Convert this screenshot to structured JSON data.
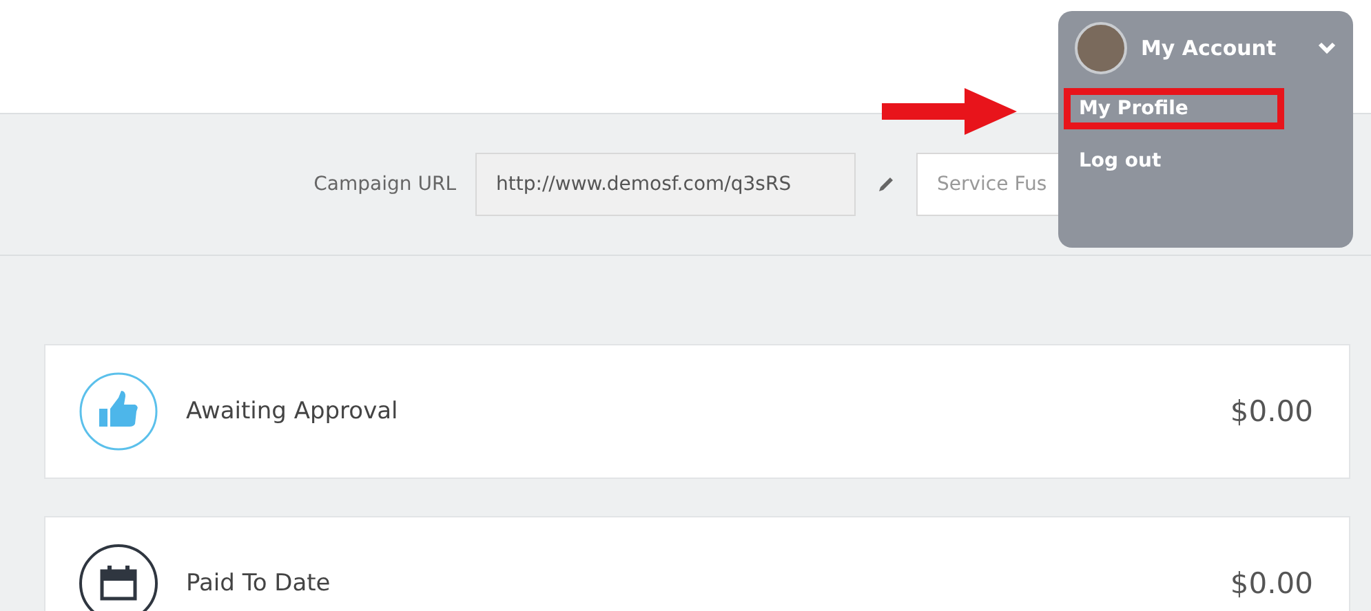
{
  "account_menu": {
    "label": "My Account",
    "expanded": true,
    "items": [
      {
        "label": "My Profile",
        "highlighted": true
      },
      {
        "label": "Log out",
        "highlighted": false
      }
    ]
  },
  "toolbar": {
    "campaign_url_label": "Campaign URL",
    "campaign_url": "http://www.demosf.com/q3sRS",
    "name_field": "Service Fus"
  },
  "cards": [
    {
      "kind": "approval",
      "label": "Awaiting Approval",
      "amount": "$0.00"
    },
    {
      "kind": "paid",
      "label": "Paid To Date",
      "amount": "$0.00"
    }
  ]
}
